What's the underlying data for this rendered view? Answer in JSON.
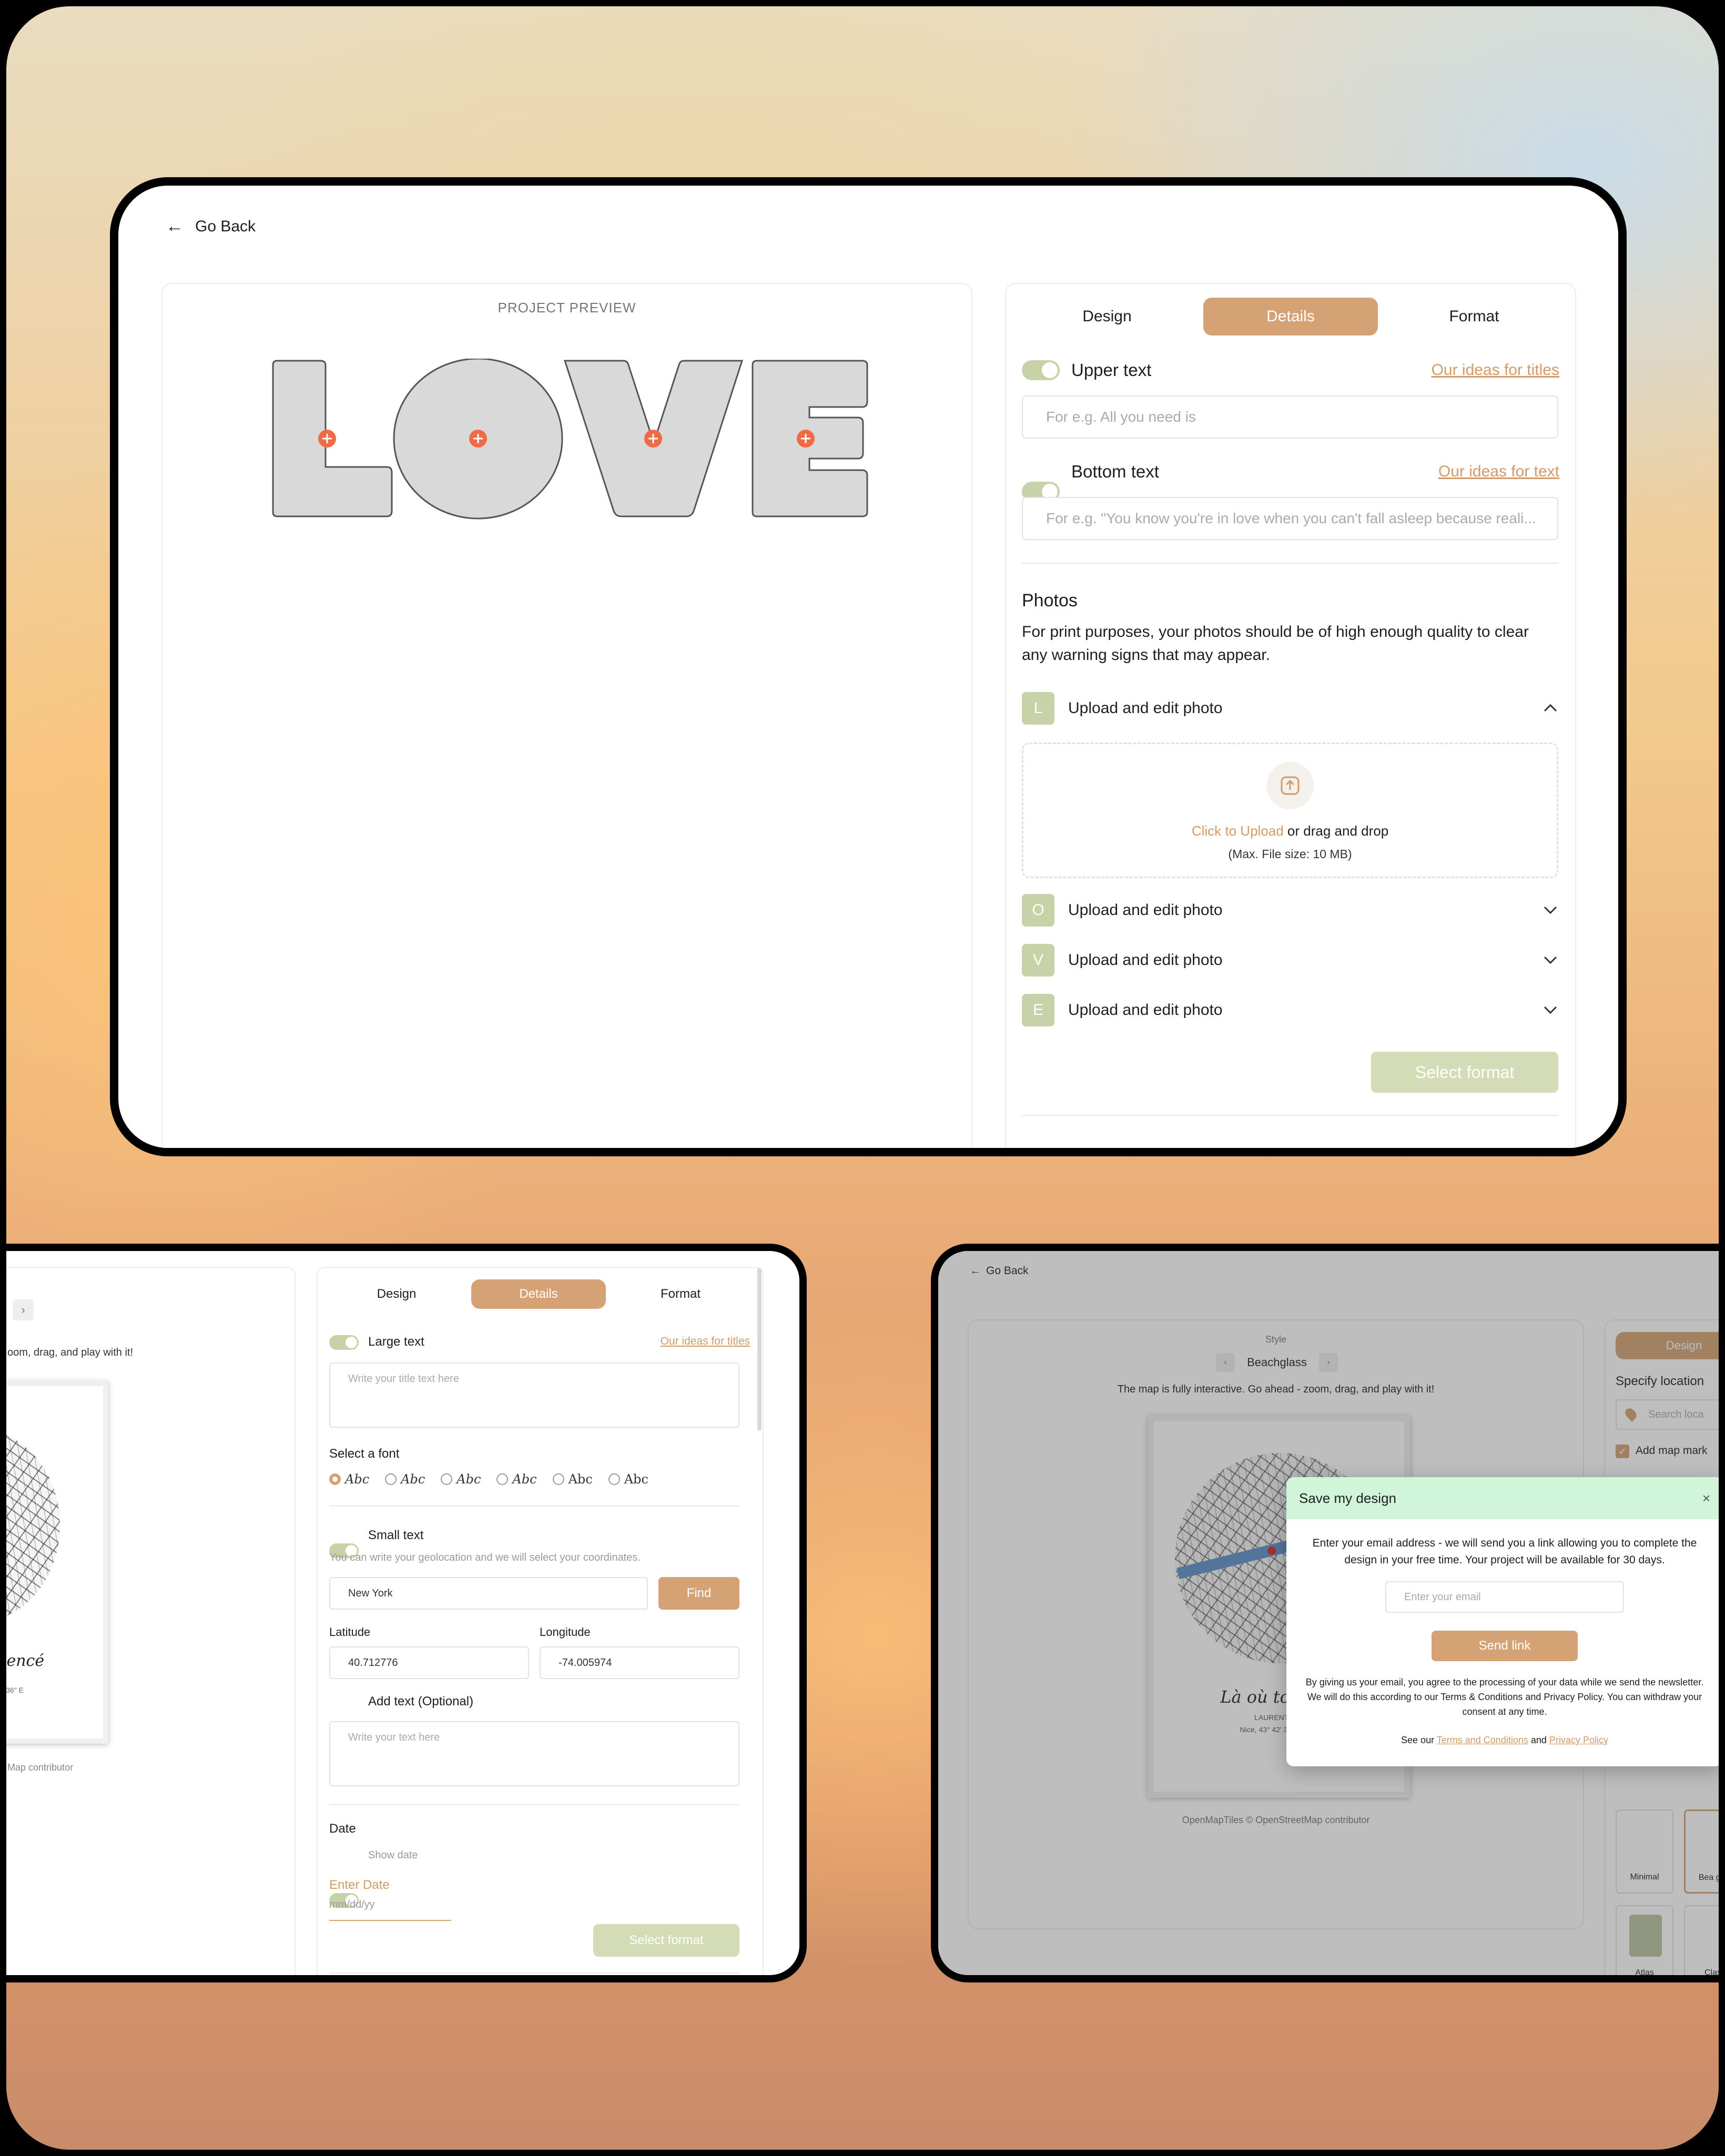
{
  "top": {
    "go_back": "Go Back",
    "preview_label": "PROJECT PREVIEW",
    "preview_word": "LOVE",
    "tabs": [
      "Design",
      "Details",
      "Format"
    ],
    "upper_text": {
      "label": "Upper text",
      "link": "Our ideas for titles",
      "placeholder": "For e.g. All you need is"
    },
    "bottom_text": {
      "label": "Bottom text",
      "link": "Our ideas for text",
      "placeholder": "For e.g. \"You know you're in love when you can't fall asleep because reali..."
    },
    "photos": {
      "title": "Photos",
      "desc": "For print purposes, your photos should be of high enough quality to clear any warning signs that may appear.",
      "items": [
        {
          "letter": "L",
          "label": "Upload and edit photo",
          "expanded": true
        },
        {
          "letter": "O",
          "label": "Upload and edit photo",
          "expanded": false
        },
        {
          "letter": "V",
          "label": "Upload and edit photo",
          "expanded": false
        },
        {
          "letter": "E",
          "label": "Upload and edit photo",
          "expanded": false
        }
      ],
      "upload_link": "Click to Upload",
      "upload_rest": "or drag and drop",
      "max_size": "(Max. File size: 10 MB)"
    },
    "select_format": "Select format",
    "colors": {
      "accent": "#d4a274",
      "green": "#c8d2a8",
      "marker": "#f06b45"
    }
  },
  "left": {
    "map_hint": "oom, drag, and play with it!",
    "map_title": "mencé",
    "map_coords": "5.0336\" E",
    "map_credit": "Map contributor",
    "tabs": [
      "Design",
      "Details",
      "Format"
    ],
    "large_text": {
      "label": "Large text",
      "link": "Our ideas for titles",
      "placeholder": "Write your title text here"
    },
    "select_font": "Select a font",
    "fonts": [
      "Abc",
      "Abc",
      "Abc",
      "Abc",
      "Abc",
      "Abc"
    ],
    "small_text": {
      "label": "Small text",
      "hint": "You can write your geolocation and we will select your coordinates."
    },
    "location_value": "New York",
    "find": "Find",
    "latitude": {
      "label": "Latitude",
      "value": "40.712776"
    },
    "longitude": {
      "label": "Longitude",
      "value": "-74.005974"
    },
    "add_text": {
      "label": "Add text (Optional)",
      "placeholder": "Write your text here"
    },
    "date": {
      "title": "Date",
      "show_date": "Show date",
      "enter_date": "Enter Date",
      "date_placeholder": "mm/dd/yy"
    },
    "select_format": "Select format"
  },
  "right": {
    "go_back": "Go Back",
    "style_label": "Style",
    "style_value": "Beachglass",
    "map_hint": "The map is fully interactive. Go ahead - zoom, drag, and play with it!",
    "map_title": "Là où tout a c",
    "map_names": "LAURENT & M",
    "map_coords": "Nice, 43° 42' 36.63\" N 7",
    "credit": "OpenMapTiles © OpenStreetMap contributor",
    "design_tab": "Design",
    "specify_location": "Specify location",
    "search_placeholder": "Search loca",
    "add_marker": "Add map mark",
    "styles": [
      "Minimal",
      "Bea gla",
      "Atlas",
      "Clas"
    ],
    "modal": {
      "title": "Save my design",
      "body": "Enter your email address - we will send you a link allowing you to complete the design in your free time. Your project will be available for 30 days.",
      "email_placeholder": "Enter your email",
      "send": "Send link",
      "consent": "By giving us your email, you agree to the processing of your data while we send the newsletter. We will do this according to our Terms & Conditions and Privacy Policy. You can withdraw your consent at any time.",
      "see_our": "See our",
      "terms": "Terms and Conditions",
      "and": "and",
      "privacy": "Privacy Policy"
    }
  }
}
